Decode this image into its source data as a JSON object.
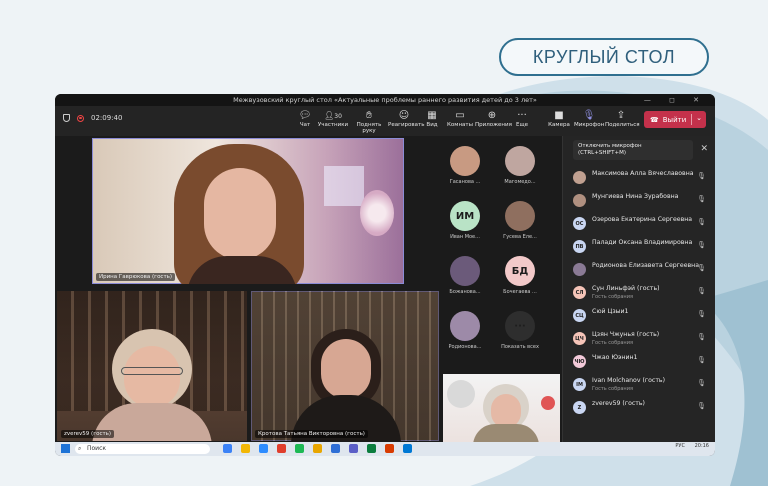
{
  "banner": {
    "label": "КРУГЛЫЙ СТОЛ"
  },
  "window": {
    "title": "Межвузовский круглый стол «Актуальные проблемы раннего развития детей до 3 лет»",
    "controls": "— ◻ ✕"
  },
  "toolbar": {
    "timer": "02:09:40",
    "chat": "Чат",
    "participants": "Участники",
    "participants_count": "30",
    "raise_hand": "Поднять руку",
    "react": "Реагировать",
    "view": "Вид",
    "rooms": "Комнаты",
    "apps": "Приложения",
    "more": "Еще",
    "camera": "Камера",
    "mic": "Микрофон",
    "share": "Поделиться",
    "leave": "Выйти"
  },
  "tiles": {
    "main": "Ирина Гаврюкова (гость)",
    "bottom_left": "zverev59 (гость)",
    "bottom_mid": "Кротова Татьяна Викторовна (гость)"
  },
  "gallery": [
    {
      "label": "Гасанова ...",
      "initials": "",
      "color": "#c89a82"
    },
    {
      "label": "Магомедо...",
      "initials": "",
      "color": "#bfa6a0"
    },
    {
      "label": "Иван Мое...",
      "initials": "ИМ",
      "color": "#b9e3c6"
    },
    {
      "label": "Гусева Еле...",
      "initials": "",
      "color": "#8f6f5f"
    },
    {
      "label": "Божанова...",
      "initials": "",
      "color": "#6b5a7a"
    },
    {
      "label": "Бочегаева ...",
      "initials": "БД",
      "color": "#f2c9c9"
    },
    {
      "label": "Родионова...",
      "initials": "",
      "color": "#9d8aa8"
    },
    {
      "label": "Показать всех",
      "initials": "···",
      "color": "#2e2e2e"
    }
  ],
  "panel": {
    "tooltip_line1": "Отключить микрофон",
    "tooltip_line2": "(CTRL+SHIFT+M)",
    "people": [
      {
        "name": "Максимова Алла Вячеславовна",
        "sub": "",
        "initials": "",
        "color": "#c0a090"
      },
      {
        "name": "Мунгиева Нина Зурабовна",
        "sub": "",
        "initials": "",
        "color": "#b09080"
      },
      {
        "name": "Озерова Екатерина Сергеевна",
        "sub": "",
        "initials": "ОС",
        "color": "#c9d6f2"
      },
      {
        "name": "Палади Оксана Владимировна",
        "sub": "",
        "initials": "ПВ",
        "color": "#c9d6f2"
      },
      {
        "name": "Родионова Елизавета Сергеевна",
        "sub": "",
        "initials": "",
        "color": "#8a7a95"
      },
      {
        "name": "Сун Линьфэй (гость)",
        "sub": "Гость собрания",
        "initials": "СЛ",
        "color": "#f5c4b8"
      },
      {
        "name": "Сюй Цзыи1",
        "sub": "",
        "initials": "СЦ",
        "color": "#c9d6f2"
      },
      {
        "name": "Цзян Чжунья (гость)",
        "sub": "Гость собрания",
        "initials": "ЦЧ",
        "color": "#f5c4b8"
      },
      {
        "name": "Чжао Юэнин1",
        "sub": "",
        "initials": "ЧЮ",
        "color": "#f2c9d9"
      },
      {
        "name": "Ivan Molchanov (гость)",
        "sub": "Гость собрания",
        "initials": "IM",
        "color": "#c9d6f2"
      },
      {
        "name": "zverev59 (гость)",
        "sub": "",
        "initials": "Z",
        "color": "#c9d6f2"
      }
    ]
  },
  "taskbar": {
    "search": "Поиск",
    "lang": "РУС",
    "time": "20:16",
    "date": ""
  }
}
